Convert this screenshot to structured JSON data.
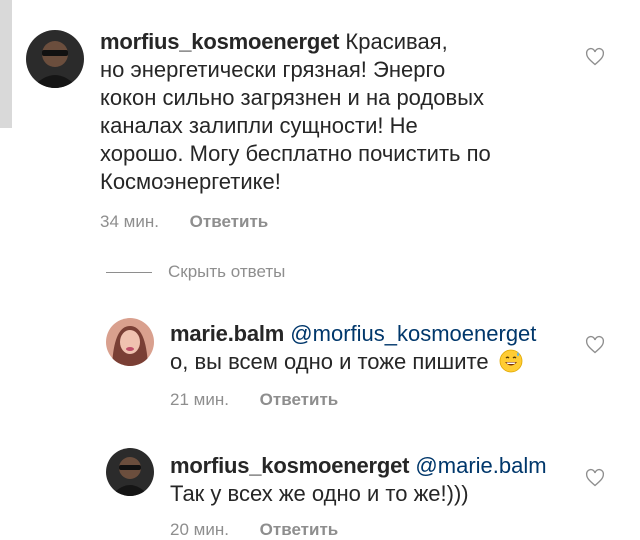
{
  "comments": [
    {
      "username": "morfius_kosmoenerget",
      "mention": "",
      "lines": [
        "Красивая,",
        "но энергетически грязная! Энерго",
        "кокон сильно загрязнен и на родовых",
        "каналах залипли сущности! Не",
        "хорошо. Могу бесплатно почистить по",
        "Космоэнергетике!"
      ],
      "time": "34 мин.",
      "reply_label": "Ответить"
    }
  ],
  "hide_replies_label": "Скрыть ответы",
  "replies": [
    {
      "username": "marie.balm",
      "mention": "@morfius_kosmoenerget",
      "text": "о, вы всем одно и тоже пишите",
      "emoji": "grinning-sweat-emoji",
      "time": "21 мин.",
      "reply_label": "Ответить"
    },
    {
      "username": "morfius_kosmoenerget",
      "mention": "@marie.balm",
      "text": "Так у всех же одно и то же!)))",
      "time": "20 мин.",
      "reply_label": "Ответить"
    }
  ],
  "colors": {
    "text": "#262626",
    "muted": "#8e8e8e",
    "mention": "#00376b"
  }
}
